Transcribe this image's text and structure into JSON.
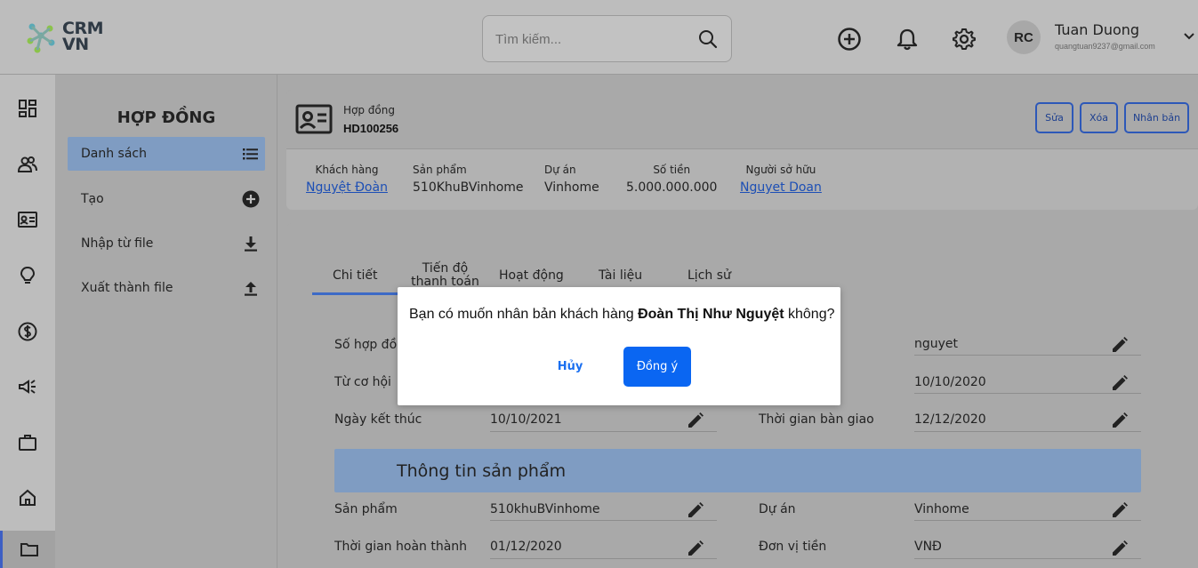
{
  "brand": {
    "line1": "CRM",
    "line2": "VN",
    "logo_icon": "dna-icon"
  },
  "search": {
    "placeholder": "Tìm kiếm..."
  },
  "user": {
    "initials": "RC",
    "name": "Tuan Duong",
    "email": "quangtuan9237@gmail.com"
  },
  "submenu": {
    "title": "HỢP ĐỒNG",
    "items": [
      {
        "label": "Danh sách",
        "icon": "list-icon"
      },
      {
        "label": "Tạo",
        "icon": "plus-circle-icon"
      },
      {
        "label": "Nhập từ file",
        "icon": "download-icon"
      },
      {
        "label": "Xuất thành file",
        "icon": "upload-icon"
      }
    ]
  },
  "contract": {
    "type_label": "Hợp đồng",
    "code": "HD100256",
    "buttons": {
      "edit": "Sửa",
      "delete": "Xóa",
      "duplicate": "Nhân bản"
    },
    "meta": [
      {
        "label": "Khách hàng",
        "value": "Nguyệt Đoàn"
      },
      {
        "label": "Sản phẩm",
        "value": "510KhuBVinhome"
      },
      {
        "label": "Dự án",
        "value": "Vinhome"
      },
      {
        "label": "Số tiền",
        "value": "5.000.000.000"
      },
      {
        "label": "Người sở hữu",
        "value": "Nguyet Doan"
      }
    ]
  },
  "tabs": [
    "Chi tiết",
    "Tiến độ thanh toán",
    "Hoạt động",
    "Tài liệu",
    "Lịch sử"
  ],
  "details": {
    "contract_no_label": "Số hợp đồ",
    "owner_value": "nguyet",
    "from_opportunity_label": "Từ cơ hội",
    "start_value": "10/10/2020",
    "end_label": "Ngày kết thúc",
    "end_value": "10/10/2021",
    "handover_label": "Thời gian bàn giao",
    "handover_value": "12/12/2020"
  },
  "product_section": {
    "title": "Thông tin sản phẩm",
    "product_label": "Sản phẩm",
    "product_value": "510khuBVinhome",
    "project_label": "Dự án",
    "project_value": "Vinhome",
    "completion_label": "Thời gian hoàn thành",
    "completion_value": "01/12/2020",
    "currency_label": "Đơn vị tiền",
    "currency_value": "VNĐ"
  },
  "dialog": {
    "prefix": "Bạn có muốn nhân bản khách hàng ",
    "name": "Đoàn Thị Như Nguyệt",
    "suffix": " không?",
    "cancel": "Hủy",
    "confirm": "Đồng ý"
  }
}
